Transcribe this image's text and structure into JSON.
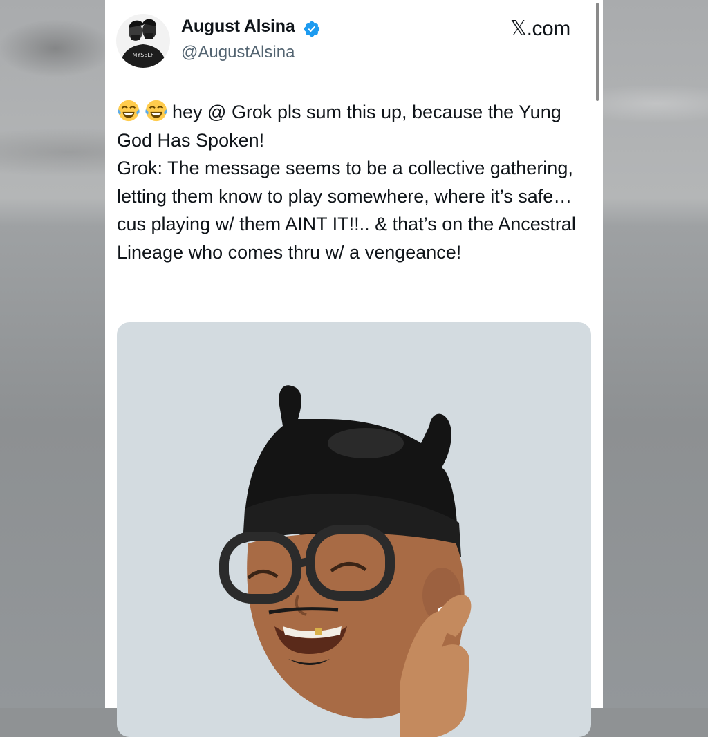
{
  "tweet": {
    "author_name": "August Alsina",
    "handle": "@AugustAlsina",
    "brand": "𝕏.com",
    "avatar_text": "MYSELF",
    "text": "hey @ Grok pls sum this up, because the Yung God Has Spoken!\nGrok: The message seems to be a collective gathering, letting them know to play somewhere, where it’s safe… cus playing w/ them AINT IT!!.. & that’s on the Ancestral Lineage who comes thru w/ a vengeance!",
    "leading_emojis": [
      "joy-emoji",
      "joy-emoji"
    ]
  },
  "icons": {
    "verified": "verified-badge-icon",
    "emoji": "face-with-tears-of-joy"
  },
  "colors": {
    "verified": "#1d9bf0",
    "text": "#0f1419",
    "secondary": "#536471",
    "media_bg": "#d3dbe0"
  }
}
